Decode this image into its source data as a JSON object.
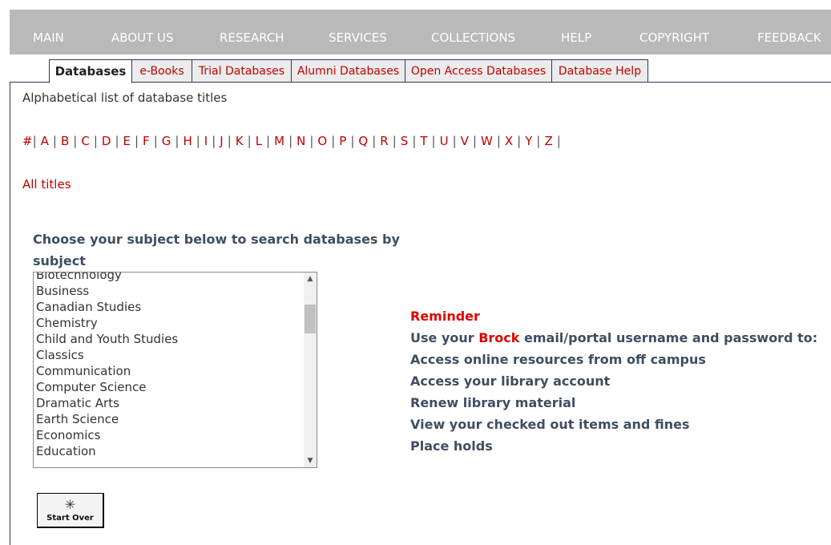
{
  "topnav": {
    "items": [
      "MAIN",
      "ABOUT US",
      "RESEARCH",
      "SERVICES",
      "COLLECTIONS",
      "HELP",
      "COPYRIGHT",
      "FEEDBACK"
    ]
  },
  "tabs": [
    "Databases",
    "e-Books",
    "Trial Databases",
    "Alumni Databases",
    "Open Access Databases",
    "Database Help"
  ],
  "intro": "Alphabetical list of database titles",
  "alphabet": [
    "#",
    "A",
    "B",
    "C",
    "D",
    "E",
    "F",
    "G",
    "H",
    "I",
    "J",
    "K",
    "L",
    "M",
    "N",
    "O",
    "P",
    "Q",
    "R",
    "S",
    "T",
    "U",
    "V",
    "W",
    "X",
    "Y",
    "Z"
  ],
  "all_titles": "All titles",
  "subject": {
    "heading": "Choose your subject below to search databases by subject",
    "items": [
      "Biotechnology",
      "Business",
      "Canadian Studies",
      "Chemistry",
      "Child and Youth Studies",
      "Classics",
      "Communication",
      "Computer Science",
      "Dramatic Arts",
      "Earth Science",
      "Economics",
      "Education"
    ]
  },
  "start_over": "Start Over",
  "reminder": {
    "title": "Reminder",
    "line1_before": "Use your ",
    "line1_brand": "Brock",
    "line1_after": " email/portal username and password to:",
    "lines": [
      "Access online resources from off campus",
      "Access your library account",
      "Renew library material",
      "View your checked out items and fines",
      "Place holds"
    ]
  },
  "colors": {
    "link": "#c00000",
    "nav_bg": "#b9b9b9",
    "heading": "#3e4e62",
    "accent": "#e00000"
  }
}
